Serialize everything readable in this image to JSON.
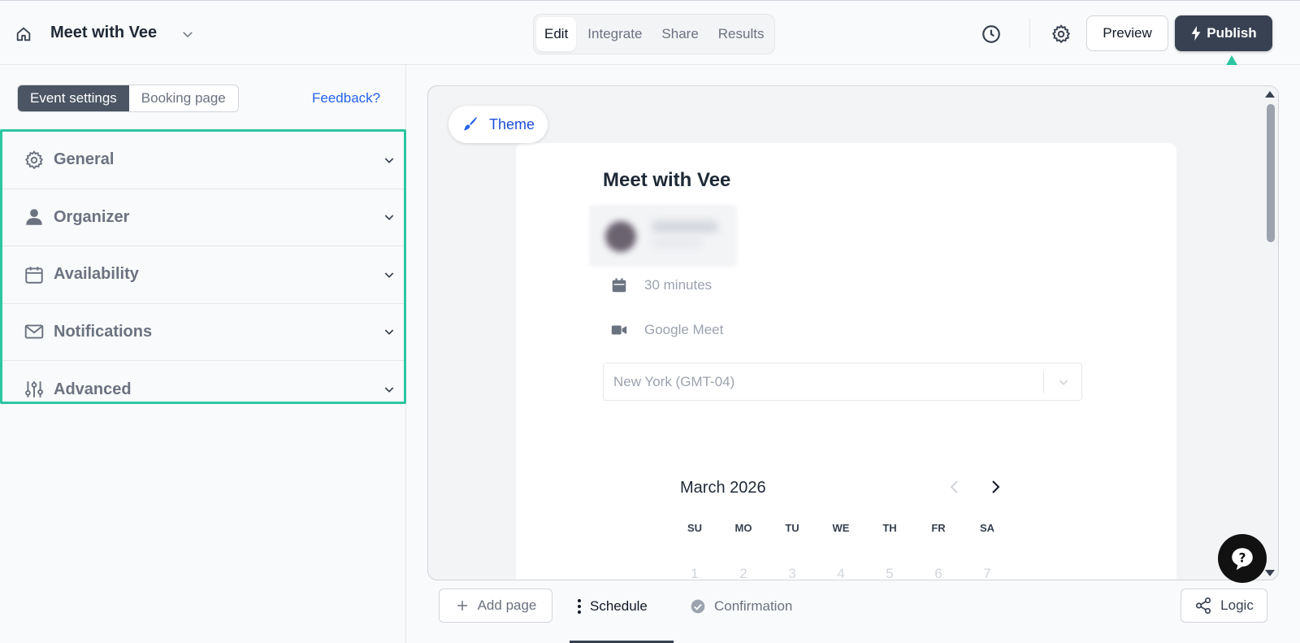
{
  "header": {
    "title": "Meet with Vee",
    "tabs": [
      {
        "label": "Edit",
        "active": true
      },
      {
        "label": "Integrate",
        "active": false
      },
      {
        "label": "Share",
        "active": false
      },
      {
        "label": "Results",
        "active": false
      }
    ],
    "preview_label": "Preview",
    "publish_label": "Publish"
  },
  "sidebar": {
    "segments": [
      {
        "label": "Event settings",
        "active": true
      },
      {
        "label": "Booking page",
        "active": false
      }
    ],
    "feedback_label": "Feedback?",
    "sections": [
      {
        "label": "General",
        "icon": "gear-icon"
      },
      {
        "label": "Organizer",
        "icon": "person-icon"
      },
      {
        "label": "Availability",
        "icon": "calendar-icon"
      },
      {
        "label": "Notifications",
        "icon": "envelope-icon"
      },
      {
        "label": "Advanced",
        "icon": "sliders-icon"
      }
    ]
  },
  "preview": {
    "theme_label": "Theme",
    "title": "Meet with Vee",
    "duration": "30 minutes",
    "location": "Google Meet",
    "timezone": "New York (GMT-04)",
    "month": "March 2026",
    "weekdays": [
      "SU",
      "MO",
      "TU",
      "WE",
      "TH",
      "FR",
      "SA"
    ],
    "days": [
      "1",
      "2",
      "3",
      "4",
      "5",
      "6",
      "7"
    ]
  },
  "bottom_bar": {
    "add_page_label": "Add page",
    "pages": [
      {
        "label": "Schedule",
        "active": true
      },
      {
        "label": "Confirmation",
        "active": false
      }
    ],
    "logic_label": "Logic"
  },
  "colors": {
    "accent_highlight": "#2dc6a0",
    "publish_bg": "#374151",
    "link": "#2563eb"
  }
}
